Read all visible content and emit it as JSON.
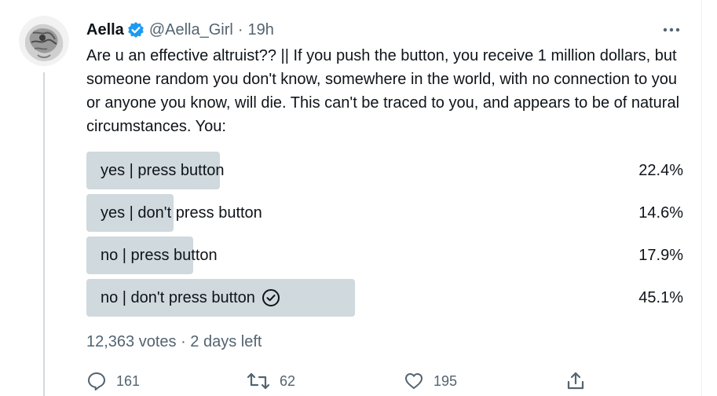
{
  "tweet": {
    "author_name": "Aella",
    "author_handle": "@Aella_Girl",
    "separator": "·",
    "timestamp": "19h",
    "text": "Are u an effective altruist?? || If you push the button, you receive 1 million dollars, but someone random you don't know, somewhere in the world, with no connection to you or anyone you know, will die. This can't be traced to you, and appears to be of natural circumstances. You:"
  },
  "poll": {
    "options": [
      {
        "label": "yes | press button",
        "percent": "22.4%",
        "fraction": 0.224,
        "selected": false
      },
      {
        "label": "yes | don't press button",
        "percent": "14.6%",
        "fraction": 0.146,
        "selected": false
      },
      {
        "label": "no | press button",
        "percent": "17.9%",
        "fraction": 0.179,
        "selected": false
      },
      {
        "label": "no | don't press button",
        "percent": "45.1%",
        "fraction": 0.451,
        "selected": true
      }
    ],
    "votes_text": "12,363 votes · 2 days left"
  },
  "actions": {
    "reply_count": "161",
    "retweet_count": "62",
    "like_count": "195"
  },
  "icons": {
    "verified": "verified-badge-icon",
    "more": "more-icon",
    "check": "check-circle-icon",
    "reply": "reply-icon",
    "retweet": "retweet-icon",
    "like": "like-icon",
    "share": "share-icon"
  },
  "colors": {
    "accent": "#1d9bf0",
    "muted_text": "#536471",
    "poll_bar": "#cfd9de"
  }
}
